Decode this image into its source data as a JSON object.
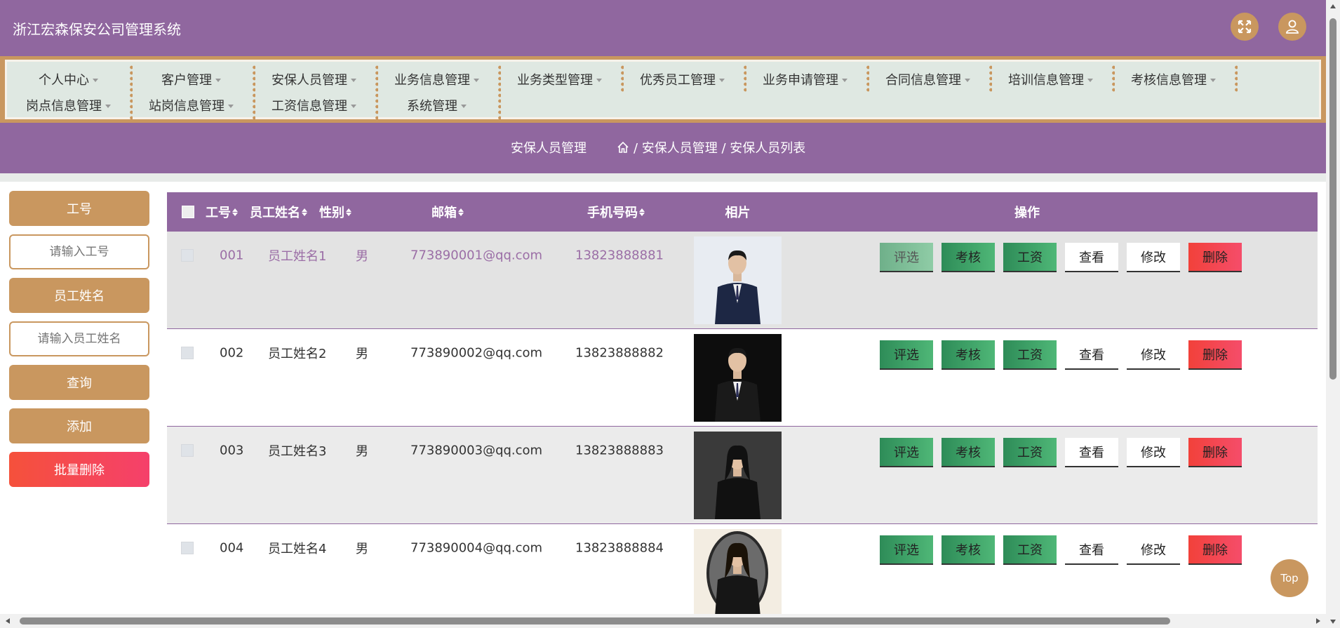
{
  "app": {
    "title": "浙江宏森保安公司管理系统"
  },
  "header": {
    "fullscreen_icon": "expand-icon",
    "user_icon": "user-icon"
  },
  "menu": [
    {
      "label": "个人中心"
    },
    {
      "label": "客户管理"
    },
    {
      "label": "安保人员管理"
    },
    {
      "label": "业务信息管理"
    },
    {
      "label": "业务类型管理"
    },
    {
      "label": "优秀员工管理"
    },
    {
      "label": "业务申请管理"
    },
    {
      "label": "合同信息管理"
    },
    {
      "label": "培训信息管理"
    },
    {
      "label": "考核信息管理"
    },
    {
      "label": "岗点信息管理"
    },
    {
      "label": "站岗信息管理"
    },
    {
      "label": "工资信息管理"
    },
    {
      "label": "系统管理"
    }
  ],
  "breadcrumb": {
    "title": "安保人员管理",
    "home_icon": "home-icon",
    "path": "/ 安保人员管理 / 安保人员列表"
  },
  "search": {
    "field1_label": "工号",
    "field1_placeholder": "请输入工号",
    "field2_label": "员工姓名",
    "field2_placeholder": "请输入员工姓名",
    "query_label": "查询",
    "add_label": "添加",
    "batch_delete_label": "批量删除"
  },
  "table": {
    "headers": {
      "id": "工号",
      "name": "员工姓名",
      "gender": "性别",
      "email": "邮箱",
      "phone": "手机号码",
      "photo": "相片",
      "ops": "操作"
    },
    "op_labels": {
      "select": "评选",
      "assess": "考核",
      "salary": "工资",
      "view": "查看",
      "edit": "修改",
      "delete": "删除"
    },
    "rows": [
      {
        "id": "001",
        "name": "员工姓名1",
        "gender": "男",
        "email": "773890001@qq.com",
        "phone": "13823888881"
      },
      {
        "id": "002",
        "name": "员工姓名2",
        "gender": "男",
        "email": "773890002@qq.com",
        "phone": "13823888882"
      },
      {
        "id": "003",
        "name": "员工姓名3",
        "gender": "男",
        "email": "773890003@qq.com",
        "phone": "13823888883"
      },
      {
        "id": "004",
        "name": "员工姓名4",
        "gender": "男",
        "email": "773890004@qq.com",
        "phone": "13823888884"
      }
    ]
  },
  "back_to_top": "Top",
  "colors": {
    "primary": "#90679f",
    "accent": "#c9975f",
    "menu_bg": "#dfe8e2",
    "green": "#2e8c58",
    "red": "#f2413a"
  }
}
